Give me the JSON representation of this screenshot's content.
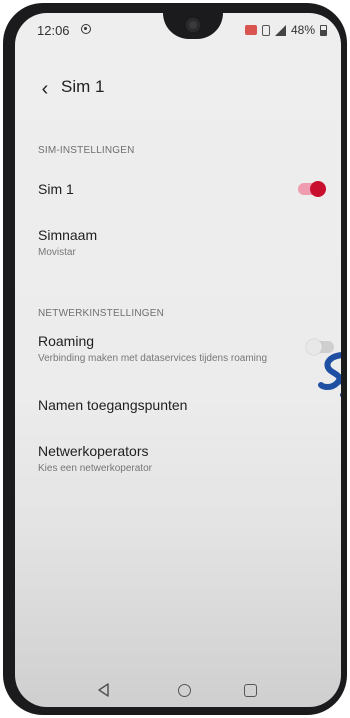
{
  "status_bar": {
    "time": "12:06",
    "battery": "48%"
  },
  "appbar": {
    "title": "Sim 1"
  },
  "sim_settings": {
    "header": "SIM-INSTELLINGEN",
    "sim_toggle": {
      "label": "Sim 1",
      "enabled": true
    },
    "sim_name": {
      "label": "Simnaam",
      "value": "Movistar"
    }
  },
  "network_settings": {
    "header": "NETWERKINSTELLINGEN",
    "roaming": {
      "label": "Roaming",
      "description": "Verbinding maken met dataservices tijdens roaming",
      "enabled": false
    },
    "access_points": {
      "label": "Namen toegangspunten"
    },
    "operators": {
      "label": "Netwerkoperators",
      "description": "Kies een netwerkoperator"
    }
  },
  "colors": {
    "accent": "#c8102e",
    "toggle_track_on": "#ef9bb0",
    "background": "#eeeeee"
  },
  "icons": {
    "back": "chevron-left-icon",
    "nav_back": "triangle-back-icon",
    "nav_home": "circle-home-icon",
    "nav_recent": "square-recent-icon"
  }
}
